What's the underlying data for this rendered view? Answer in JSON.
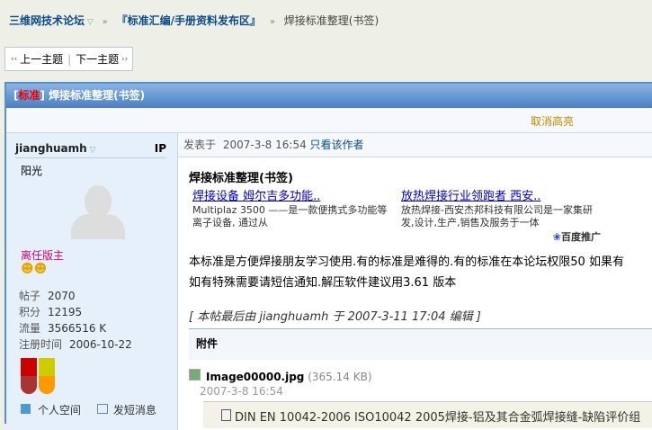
{
  "breadcrumb": {
    "forum": "三维网技术论坛",
    "board": "『标准汇编/手册资料发布区』",
    "current": "焊接标准整理(书签)"
  },
  "nav": {
    "prev": "上一主题",
    "next": "下一主题"
  },
  "thread": {
    "tag": "标准",
    "title": "焊接标准整理(书签)",
    "cancel_highlight": "取消高亮"
  },
  "author": {
    "name": "jianghuamh",
    "ip": "IP",
    "title": "阳光",
    "rank": "离任版主",
    "stats": [
      {
        "label": "帖子",
        "value": "2070"
      },
      {
        "label": "积分",
        "value": "12195"
      },
      {
        "label": "流量",
        "value": "3566516 K"
      },
      {
        "label": "注册时间",
        "value": "2006-10-22"
      }
    ],
    "space": "个人空间",
    "message": "发短消息"
  },
  "post": {
    "posted_label": "发表于",
    "date": "2007-3-8 16:54",
    "only_author": "只看该作者",
    "title": "焊接标准整理(书签)",
    "ads": [
      {
        "title": "焊接设备 姆尔吉多功能..",
        "desc": "Multiplaz 3500 ——是一款便携式多功能等离子设备, 通过从"
      },
      {
        "title": "放热焊接行业领跑者 西安..",
        "desc": "放热焊接-西安杰邦科技有限公司是一家集研发,设计,生产,销售及服务于一体"
      }
    ],
    "ad_brand": "百度推广",
    "body1": "本标准是方便焊接朋友学习使用.有的标准是难得的.有的标准在本论坛权限50  如果有",
    "body2": "如有特殊需要请短信通知.解压软件建议用3.61 版本",
    "edited": "[ 本帖最后由 jianghuamh 于 2007-3-11 17:04 编辑 ]",
    "attach_header": "附件",
    "attach_name": "Image00000.jpg",
    "attach_size": "(365.14 KB)",
    "attach_date": "2007-3-8 16:54",
    "file_line": "DIN EN 10042-2006 ISO10042 2005焊接-铝及其合金弧焊接缝-缺陷评价组"
  }
}
